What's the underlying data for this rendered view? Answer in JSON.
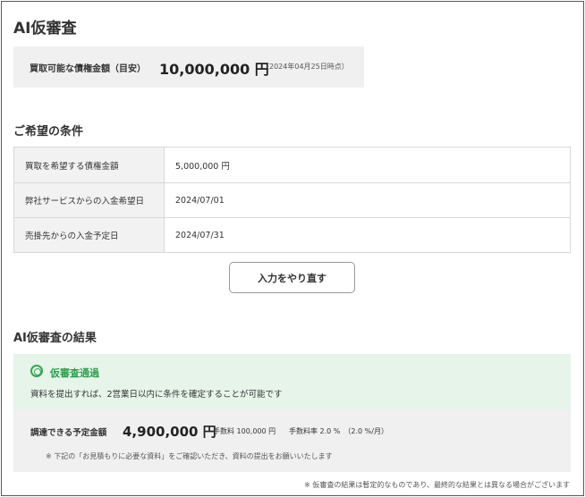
{
  "page": {
    "title": "AI仮審査"
  },
  "estimate": {
    "label": "買取可能な債権金額（目安）",
    "value": "10,000,000 円",
    "as_of": "（2024年04月25日時点）"
  },
  "conditions": {
    "heading": "ご希望の条件",
    "rows": [
      {
        "key": "買取を希望する債権金額",
        "value": "5,000,000 円"
      },
      {
        "key": "弊社サービスからの入金希望日",
        "value": "2024/07/01"
      },
      {
        "key": "売掛先からの入金予定日",
        "value": "2024/07/31"
      }
    ],
    "redo_button": "入力をやり直す"
  },
  "result": {
    "heading": "AI仮審査の結果",
    "status_title": "仮審査通過",
    "status_desc": "資料を提出すれば、2営業日以内に条件を確定することが可能です",
    "amount_label": "調達できる予定金額",
    "amount_value": "4,900,000 円",
    "fee": "手数料 100,000 円",
    "fee_rate": "手数料率 2.0 %　（2.0 %/月）",
    "note": "※ 下記の「お見積もりに必要な資料」をご確認いただき、資料の提出をお願いいたします",
    "status_color": "#3aa657"
  },
  "footnote": "※ 仮審査の結果は暫定的なものであり、最終的な結果とは異なる場合がございます"
}
